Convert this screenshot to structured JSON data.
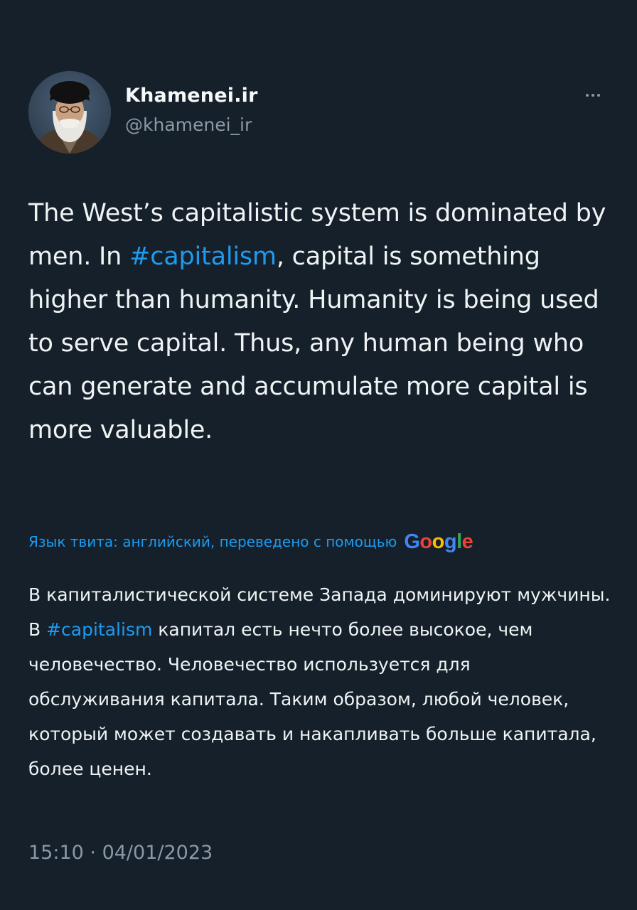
{
  "author": {
    "display_name": "Khamenei.ir",
    "handle": "@khamenei_ir"
  },
  "more_icon": "more-horizontal-icon",
  "tweet": {
    "text_before": "The West’s capitalistic system is dominated by men. In ",
    "hashtag": "#capitalism",
    "text_after": ", capital is something higher than humanity. Humanity is being used to serve capital. Thus, any human being who can generate and accumulate more capital is more valuable."
  },
  "translation": {
    "note": "Язык твита: английский, переведено с помощью",
    "provider_letters": [
      "G",
      "o",
      "o",
      "g",
      "l",
      "e"
    ],
    "text_before": "В капиталистической системе Запада доминируют мужчины. В ",
    "hashtag": "#capitalism",
    "text_after": " капитал есть нечто более высокое, чем человечество. Человечество используется для обслуживания капитала. Таким образом, любой человек, который может создавать и накапливать больше капитала, более ценен."
  },
  "timestamp": {
    "time": "15:10",
    "separator": " · ",
    "date": "04/01/2023"
  },
  "colors": {
    "background": "#15202b",
    "text": "#eff3f4",
    "secondary": "#8b98a5",
    "accent": "#1d9bf0"
  }
}
